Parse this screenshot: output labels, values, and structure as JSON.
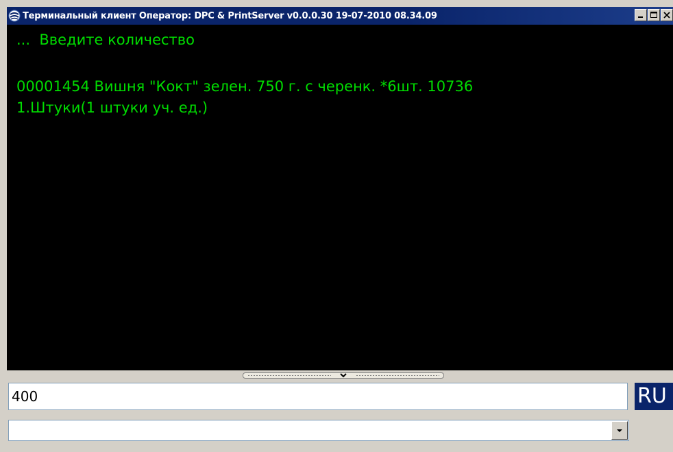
{
  "window": {
    "title": "Терминальный клиент Оператор: DPC & PrintServer v0.0.0.30 19-07-2010 08.34.09",
    "icons": {
      "app": "terminal-client-icon",
      "minimize": "minimize-icon",
      "maximize": "maximize-icon",
      "close": "close-icon"
    }
  },
  "terminal": {
    "prompt": "...  Введите количество",
    "item_line": "00001454 Вишня \"Кокт\" зелен. 750 г. с черенк. *6шт. 10736",
    "unit_line": "1.Штуки(1 штуки уч. ед.)",
    "text_color": "#00dd00",
    "background": "#000000"
  },
  "splitter": {
    "icon": "chevron-down-icon"
  },
  "input": {
    "value": "400"
  },
  "language": {
    "label": "RU"
  },
  "combo": {
    "selected": "",
    "icon": "dropdown-arrow-icon"
  }
}
